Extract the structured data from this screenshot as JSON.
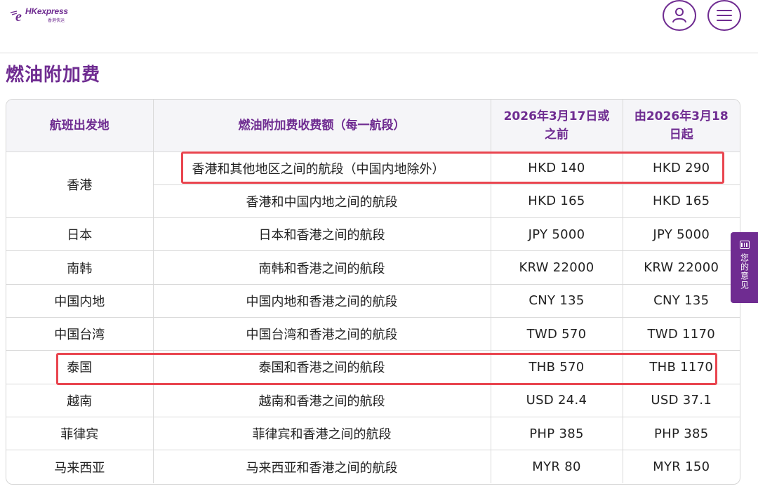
{
  "header": {
    "logo_text": "HKexpress",
    "logo_sub": "香港快运",
    "user_icon": "user-icon",
    "menu_icon": "menu-icon"
  },
  "page": {
    "title": "燃油附加费"
  },
  "table": {
    "columns": [
      "航班出发地",
      "燃油附加费收费额（每一航段）",
      "2026年3月17日或之前",
      "由2026年3月18日起"
    ],
    "rows": [
      {
        "origin": "香港",
        "segment": "香港和其他地区之间的航段（中国内地除外）",
        "before": "HKD 140",
        "after": "HKD 290"
      },
      {
        "origin": "",
        "segment": "香港和中国内地之间的航段",
        "before": "HKD 165",
        "after": "HKD 165"
      },
      {
        "origin": "日本",
        "segment": "日本和香港之间的航段",
        "before": "JPY 5000",
        "after": "JPY 5000"
      },
      {
        "origin": "南韩",
        "segment": "南韩和香港之间的航段",
        "before": "KRW 22000",
        "after": "KRW 22000"
      },
      {
        "origin": "中国内地",
        "segment": "中国内地和香港之间的航段",
        "before": "CNY 135",
        "after": "CNY 135"
      },
      {
        "origin": "中国台湾",
        "segment": "中国台湾和香港之间的航段",
        "before": "TWD 570",
        "after": "TWD 1170"
      },
      {
        "origin": "泰国",
        "segment": "泰国和香港之间的航段",
        "before": "THB 570",
        "after": "THB 1170"
      },
      {
        "origin": "越南",
        "segment": "越南和香港之间的航段",
        "before": "USD 24.4",
        "after": "USD 37.1"
      },
      {
        "origin": "菲律宾",
        "segment": "菲律宾和香港之间的航段",
        "before": "PHP 385",
        "after": "PHP 385"
      },
      {
        "origin": "马来西亚",
        "segment": "马来西亚和香港之间的航段",
        "before": "MYR 80",
        "after": "MYR 150"
      }
    ]
  },
  "feedback": {
    "label": "您的意见",
    "icon": "feedback-icon"
  },
  "colors": {
    "brand": "#6f2c91",
    "highlight": "#e9454f",
    "header_bg": "#f5f5f8"
  }
}
